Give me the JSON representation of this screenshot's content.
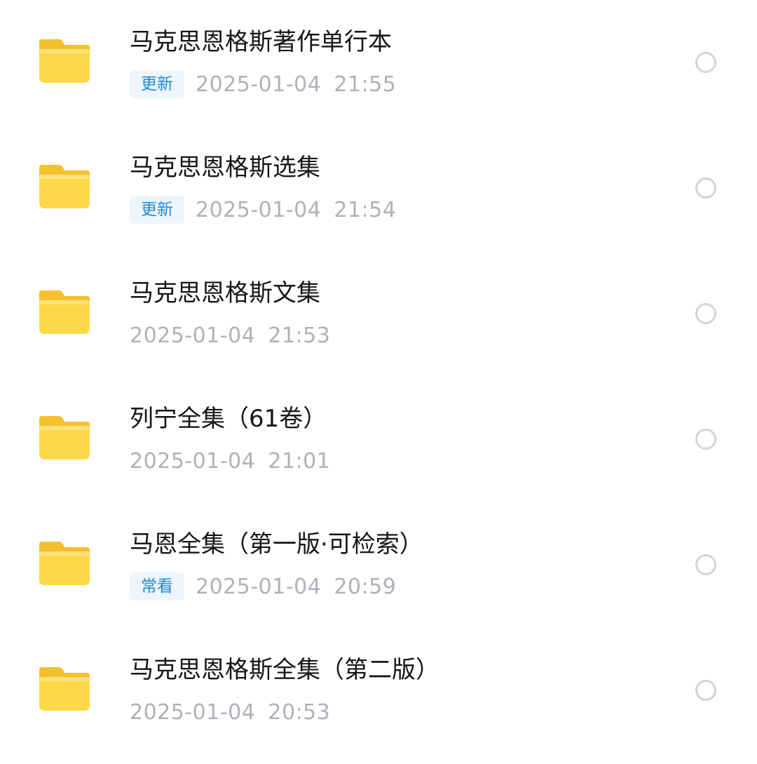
{
  "files": [
    {
      "name": "马克思恩格斯著作单行本",
      "badge": "更新",
      "timestamp": "2025-01-04  21:55"
    },
    {
      "name": "马克思恩格斯选集",
      "badge": "更新",
      "timestamp": "2025-01-04  21:54"
    },
    {
      "name": "马克思恩格斯文集",
      "badge": "",
      "timestamp": "2025-01-04  21:53"
    },
    {
      "name": "列宁全集（61卷）",
      "badge": "",
      "timestamp": "2025-01-04  21:01"
    },
    {
      "name": "马恩全集（第一版·可检索）",
      "badge": "常看",
      "timestamp": "2025-01-04  20:59"
    },
    {
      "name": "马克思恩格斯全集（第二版）",
      "badge": "",
      "timestamp": "2025-01-04  20:53"
    }
  ],
  "icons": {
    "folder": "folder-icon",
    "select": "radio-circle-icon"
  },
  "colors": {
    "folder_front": "#FFD84A",
    "folder_back": "#F5C02E",
    "badge_text": "#1F8AD6",
    "badge_bg": "#EEF6FB",
    "timestamp": "#AEB2B8",
    "title": "#161616"
  }
}
